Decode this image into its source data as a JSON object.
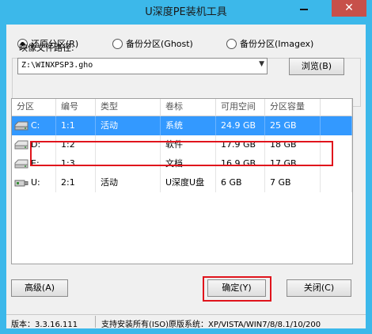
{
  "window": {
    "title": "U深度PE装机工具",
    "close_glyph": "✕"
  },
  "mode": {
    "options": [
      {
        "label": "还原分区(R)",
        "checked": true
      },
      {
        "label": "备份分区(Ghost)",
        "checked": false
      },
      {
        "label": "备份分区(Imagex)",
        "checked": false
      }
    ]
  },
  "image": {
    "label": "映像文件路径:",
    "path": "Z:\\WINXPSP3.gho",
    "browse_label": "浏览(B)"
  },
  "table": {
    "headers": [
      "分区",
      "编号",
      "类型",
      "卷标",
      "可用空间",
      "分区容量",
      ""
    ],
    "rows": [
      {
        "part": "C:",
        "num": "1:1",
        "type": "活动",
        "label": "系统",
        "free": "24.9 GB",
        "size": "25 GB",
        "icon": "hdd-icon",
        "selected": true
      },
      {
        "part": "D:",
        "num": "1:2",
        "type": "",
        "label": "软件",
        "free": "17.9 GB",
        "size": "18 GB",
        "icon": "hdd-icon",
        "selected": false
      },
      {
        "part": "E:",
        "num": "1:3",
        "type": "",
        "label": "文档",
        "free": "16.9 GB",
        "size": "17 GB",
        "icon": "hdd-icon",
        "selected": false
      },
      {
        "part": "U:",
        "num": "2:1",
        "type": "活动",
        "label": "U深度U盘",
        "free": "6 GB",
        "size": "7 GB",
        "icon": "usb-drive-icon",
        "selected": false
      }
    ]
  },
  "buttons": {
    "advanced": "高级(A)",
    "ok": "确定(Y)",
    "close": "关闭(C)"
  },
  "status": {
    "version": "版本：3.3.16.111",
    "support": "支持安装所有(ISO)原版系统：XP/VISTA/WIN7/8/8.1/10/200"
  },
  "colors": {
    "title_bar": "#3cb8ea",
    "selected_row": "#3399ff",
    "highlight": "#e0141c",
    "close_button": "#c7504a"
  }
}
